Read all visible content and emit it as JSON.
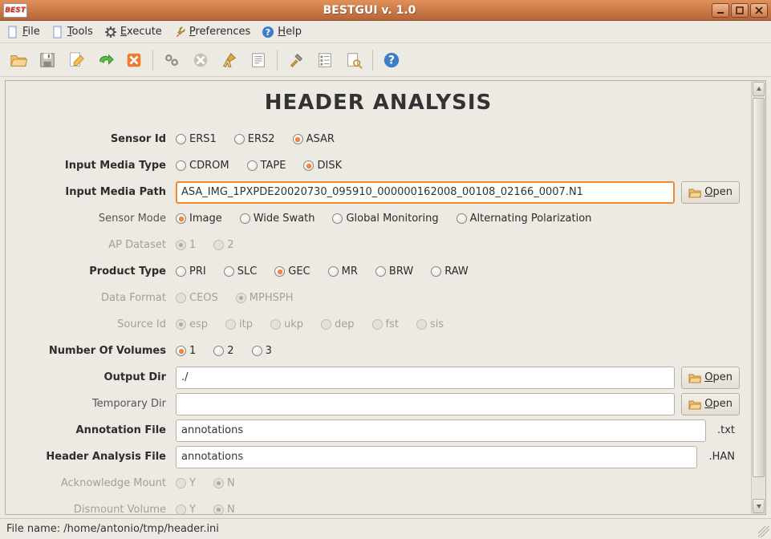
{
  "window": {
    "app_badge": "BEST",
    "title": "BESTGUI v. 1.0"
  },
  "menubar": [
    {
      "label": "File",
      "key": "F",
      "icon": "document-icon"
    },
    {
      "label": "Tools",
      "key": "T",
      "icon": "document-icon"
    },
    {
      "label": "Execute",
      "key": "E",
      "icon": "gear-icon"
    },
    {
      "label": "Preferences",
      "key": "P",
      "icon": "wrench-icon"
    },
    {
      "label": "Help",
      "key": "H",
      "icon": "help-icon"
    }
  ],
  "toolbar": {
    "icons": [
      "open-folder-icon",
      "save-floppy-icon",
      "edit-document-icon",
      "arrow-redo-icon",
      "close-x-icon",
      "|",
      "gears-icon",
      "cancel-circle-icon",
      "broom-icon",
      "log-icon",
      "|",
      "tools-icon",
      "checklist-icon",
      "docsearch-icon",
      "|",
      "help-icon"
    ]
  },
  "page": {
    "title": "HEADER ANALYSIS"
  },
  "form": {
    "sensor_id": {
      "label": "Sensor Id",
      "options": [
        "ERS1",
        "ERS2",
        "ASAR"
      ],
      "selected": "ASAR",
      "enabled": true
    },
    "input_media_type": {
      "label": "Input Media Type",
      "options": [
        "CDROM",
        "TAPE",
        "DISK"
      ],
      "selected": "DISK",
      "enabled": true
    },
    "input_media_path": {
      "label": "Input Media Path",
      "value": "ASA_IMG_1PXPDE20020730_095910_000000162008_00108_02166_0007.N1",
      "open_label": "Open"
    },
    "sensor_mode": {
      "label": "Sensor Mode",
      "options": [
        "Image",
        "Wide Swath",
        "Global Monitoring",
        "Alternating Polarization"
      ],
      "selected": "Image",
      "enabled": true
    },
    "ap_dataset": {
      "label": "AP Dataset",
      "options": [
        "1",
        "2"
      ],
      "selected": "1",
      "enabled": false
    },
    "product_type": {
      "label": "Product Type",
      "options": [
        "PRI",
        "SLC",
        "GEC",
        "MR",
        "BRW",
        "RAW"
      ],
      "selected": "GEC",
      "enabled": true
    },
    "data_format": {
      "label": "Data Format",
      "options": [
        "CEOS",
        "MPHSPH"
      ],
      "selected": "MPHSPH",
      "enabled": false
    },
    "source_id": {
      "label": "Source Id",
      "options": [
        "esp",
        "itp",
        "ukp",
        "dep",
        "fst",
        "sis"
      ],
      "selected": "esp",
      "enabled": false
    },
    "num_volumes": {
      "label": "Number Of Volumes",
      "options": [
        "1",
        "2",
        "3"
      ],
      "selected": "1",
      "enabled": true
    },
    "output_dir": {
      "label": "Output Dir",
      "value": "./",
      "open_label": "Open"
    },
    "temporary_dir": {
      "label": "Temporary Dir",
      "value": "",
      "open_label": "Open"
    },
    "annotation_file": {
      "label": "Annotation File",
      "value": "annotations",
      "ext": ".txt"
    },
    "header_file": {
      "label": "Header Analysis File",
      "value": "annotations",
      "ext": ".HAN"
    },
    "ack_mount": {
      "label": "Acknowledge Mount",
      "options": [
        "Y",
        "N"
      ],
      "selected": "N",
      "enabled": false
    },
    "dismount": {
      "label": "Dismount Volume",
      "options": [
        "Y",
        "N"
      ],
      "selected": "N",
      "enabled": false
    }
  },
  "statusbar": {
    "text": "File name: /home/antonio/tmp/header.ini"
  }
}
